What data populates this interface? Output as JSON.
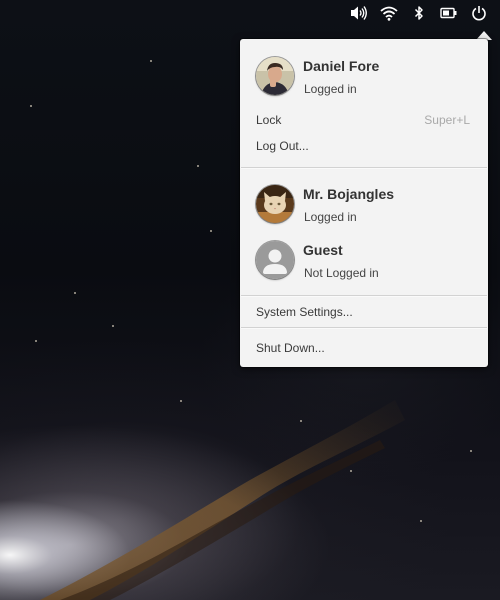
{
  "panel": {
    "indicators": [
      {
        "name": "volume-icon"
      },
      {
        "name": "wifi-icon"
      },
      {
        "name": "bluetooth-icon"
      },
      {
        "name": "battery-icon"
      },
      {
        "name": "power-icon"
      }
    ]
  },
  "menu": {
    "current_user": {
      "name": "Daniel Fore",
      "status": "Logged in"
    },
    "lock": {
      "label": "Lock",
      "accelerator": "Super+L"
    },
    "logout": {
      "label": "Log Out..."
    },
    "other_users": [
      {
        "name": "Mr. Bojangles",
        "status": "Logged in"
      },
      {
        "name": "Guest",
        "status": "Not Logged in"
      }
    ],
    "system_settings": {
      "label": "System Settings..."
    },
    "shutdown": {
      "label": "Shut Down..."
    }
  },
  "colors": {
    "menu_background": "#f3f3f3",
    "text": "#333333",
    "accelerator": "#a9a9a9",
    "panel_icons": "#ffffff"
  }
}
